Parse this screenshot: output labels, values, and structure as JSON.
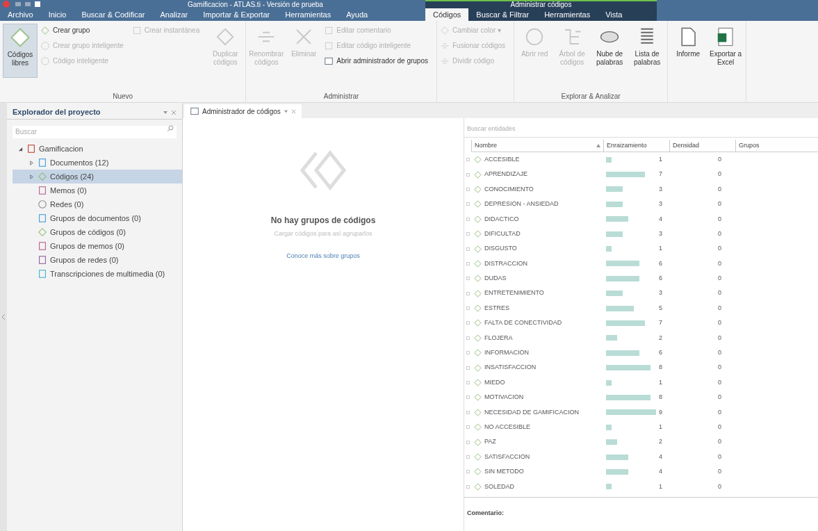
{
  "window": {
    "title": "Gamificacion - ATLAS.ti - Versión de prueba"
  },
  "menu_tabs": [
    {
      "label": "Archivo",
      "selected": false
    },
    {
      "label": "Inicio",
      "selected": false
    },
    {
      "label": "Buscar & Codificar",
      "selected": false
    },
    {
      "label": "Analizar",
      "selected": false
    },
    {
      "label": "Importar & Exportar",
      "selected": false
    },
    {
      "label": "Herramientas",
      "selected": false
    },
    {
      "label": "Ayuda",
      "selected": false
    }
  ],
  "context_group": {
    "label": "Administrar códigos",
    "tabs": [
      {
        "label": "Códigos",
        "selected": true
      },
      {
        "label": "Buscar & Filtrar",
        "selected": false
      },
      {
        "label": "Herramientas",
        "selected": false
      },
      {
        "label": "Vista",
        "selected": false
      }
    ]
  },
  "ribbon": [
    {
      "label": "Nuevo",
      "items": [
        {
          "kind": "large",
          "label": "Códigos libres",
          "disabled": false,
          "pressed": true
        },
        {
          "kind": "stack",
          "items": [
            {
              "label": "Crear grupo",
              "disabled": false
            },
            {
              "label": "Crear grupo inteligente",
              "disabled": true
            },
            {
              "label": "Código inteligente",
              "disabled": true
            }
          ]
        },
        {
          "kind": "stack",
          "items": [
            {
              "label": "Crear instantánea",
              "disabled": true
            }
          ]
        },
        {
          "kind": "large",
          "label": "Duplicar códigos",
          "disabled": true,
          "pressed": false
        }
      ]
    },
    {
      "label": "Administrar",
      "items": [
        {
          "kind": "large",
          "label": "Renombrar códigos",
          "disabled": true,
          "pressed": false
        },
        {
          "kind": "large",
          "label": "Eliminar",
          "disabled": true,
          "pressed": false
        },
        {
          "kind": "stack",
          "items": [
            {
              "label": "Editar comentario",
              "disabled": true
            },
            {
              "label": "Editar código inteligente",
              "disabled": true
            },
            {
              "label": "Abrir administrador de grupos",
              "disabled": false
            }
          ]
        }
      ]
    },
    {
      "items": [
        {
          "kind": "stack",
          "items": [
            {
              "label": "Cambiar color ▾",
              "disabled": true
            },
            {
              "label": "Fusionar códigos",
              "disabled": true
            },
            {
              "label": "Dividir código",
              "disabled": true
            }
          ]
        }
      ]
    },
    {
      "label": "Explorar & Analizar",
      "items": [
        {
          "kind": "large",
          "label": "Abrir red",
          "disabled": true,
          "pressed": false
        },
        {
          "kind": "large",
          "label": "Árbol de códigos",
          "disabled": true,
          "pressed": false
        },
        {
          "kind": "large",
          "label": "Nube de palabras",
          "disabled": false,
          "pressed": false
        },
        {
          "kind": "large",
          "label": "Lista de palabras",
          "disabled": false,
          "pressed": false
        }
      ]
    },
    {
      "items": [
        {
          "kind": "large",
          "label": "Informe",
          "disabled": false,
          "pressed": false
        },
        {
          "kind": "large",
          "label": "Exportar a Excel",
          "disabled": false,
          "pressed": false
        }
      ]
    }
  ],
  "explorer": {
    "title": "Explorador del proyecto",
    "search_placeholder": "Buscar",
    "tree": [
      {
        "label": "Gamificacion",
        "expanded": true,
        "selected": false,
        "children": [
          {
            "label": "Documentos (12)",
            "expanded": false,
            "selected": false
          },
          {
            "label": "Códigos (24)",
            "expanded": false,
            "selected": true
          },
          {
            "label": "Memos (0)",
            "selected": false
          },
          {
            "label": "Redes (0)",
            "selected": false
          },
          {
            "label": "Grupos de documentos (0)",
            "selected": false
          },
          {
            "label": "Grupos de códigos (0)",
            "selected": false
          },
          {
            "label": "Grupos de memos (0)",
            "selected": false
          },
          {
            "label": "Grupos de redes (0)",
            "selected": false
          },
          {
            "label": "Transcripciones de multimedia (0)",
            "selected": false
          }
        ]
      }
    ]
  },
  "doc_tab": {
    "label": "Administrador de códigos",
    "selected": true
  },
  "groups_pane": {
    "title": "No hay grupos de códigos",
    "subtitle": "Cargar códigos para así agruparlos",
    "link": "Conoce más sobre grupos"
  },
  "codes": {
    "search_placeholder": "Buscar entidades",
    "columns": [
      {
        "label": "Nombre",
        "sorted": true
      },
      {
        "label": "Enraizamiento",
        "sorted": false
      },
      {
        "label": "Densidad",
        "sorted": false
      },
      {
        "label": "Grupos",
        "sorted": false
      }
    ],
    "rows": [
      {
        "name": "ACCESIBLE",
        "rooting": "1",
        "density": "0"
      },
      {
        "name": "APRENDIZAJE",
        "rooting": "7",
        "density": "0"
      },
      {
        "name": "CONOCIMIENTO",
        "rooting": "3",
        "density": "0"
      },
      {
        "name": "DEPRESION - ANSIEDAD",
        "rooting": "3",
        "density": "0"
      },
      {
        "name": "DIDACTICO",
        "rooting": "4",
        "density": "0"
      },
      {
        "name": "DIFICULTAD",
        "rooting": "3",
        "density": "0"
      },
      {
        "name": "DISGUSTO",
        "rooting": "1",
        "density": "0"
      },
      {
        "name": "DISTRACCION",
        "rooting": "6",
        "density": "0"
      },
      {
        "name": "DUDAS",
        "rooting": "6",
        "density": "0"
      },
      {
        "name": "ENTRETENIMIENTO",
        "rooting": "3",
        "density": "0"
      },
      {
        "name": "ESTRES",
        "rooting": "5",
        "density": "0"
      },
      {
        "name": "FALTA DE CONECTIVIDAD",
        "rooting": "7",
        "density": "0"
      },
      {
        "name": "FLOJERA",
        "rooting": "2",
        "density": "0"
      },
      {
        "name": "INFORMACION",
        "rooting": "6",
        "density": "0"
      },
      {
        "name": "INSATISFACCION",
        "rooting": "8",
        "density": "0"
      },
      {
        "name": "MIEDO",
        "rooting": "1",
        "density": "0"
      },
      {
        "name": "MOTIVACION",
        "rooting": "8",
        "density": "0"
      },
      {
        "name": "NECESIDAD DE GAMIFICACION",
        "rooting": "9",
        "density": "0"
      },
      {
        "name": "NO ACCESIBLE",
        "rooting": "1",
        "density": "0"
      },
      {
        "name": "PAZ",
        "rooting": "2",
        "density": "0"
      },
      {
        "name": "SATISFACCION",
        "rooting": "4",
        "density": "0"
      },
      {
        "name": "SIN METODO",
        "rooting": "4",
        "density": "0"
      },
      {
        "name": "SOLEDAD",
        "rooting": "1",
        "density": "0"
      }
    ],
    "comment_label": "Comentario:"
  }
}
